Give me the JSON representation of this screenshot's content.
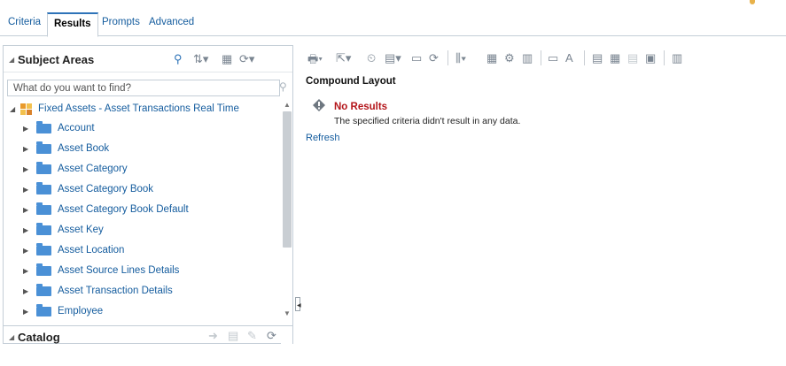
{
  "tabs": [
    {
      "label": "Criteria"
    },
    {
      "label": "Results"
    },
    {
      "label": "Prompts"
    },
    {
      "label": "Advanced"
    }
  ],
  "active_tab": "Results",
  "subject_areas": {
    "title": "Subject Areas",
    "search_placeholder": "What do you want to find?",
    "root": "Fixed Assets - Asset Transactions Real Time",
    "folders": [
      "Account",
      "Asset Book",
      "Asset Category",
      "Asset Category Book",
      "Asset Category Book Default",
      "Asset Key",
      "Asset Location",
      "Asset Source Lines Details",
      "Asset Transaction Details",
      "Employee"
    ]
  },
  "catalog": {
    "title": "Catalog"
  },
  "results": {
    "view_title": "Compound Layout",
    "status_title": "No Results",
    "status_message": "The specified criteria didn't result in any data.",
    "refresh_label": "Refresh"
  },
  "colors": {
    "link": "#145c9e",
    "folder": "#4a90d6",
    "error": "#b4161b",
    "active_tab_accent": "#2e73b8"
  }
}
